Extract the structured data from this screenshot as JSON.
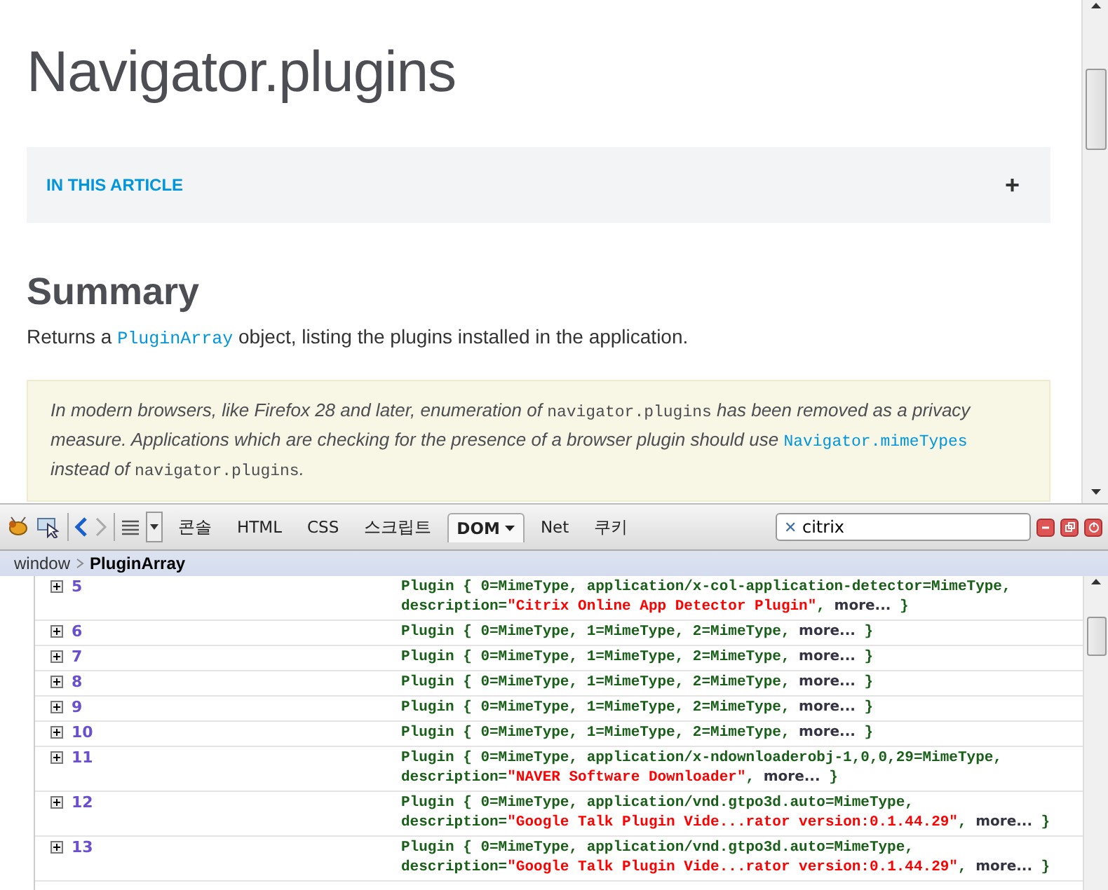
{
  "article": {
    "title": "Navigator.plugins",
    "toc": {
      "label": "IN THIS ARTICLE",
      "toggle": "+",
      "expanded": false
    },
    "heading": "Summary",
    "summary": [
      {
        "kind": "text",
        "text": "Returns a "
      },
      {
        "kind": "link",
        "text": "PluginArray"
      },
      {
        "kind": "text",
        "text": " object, listing the plugins installed in the application."
      }
    ],
    "note": [
      {
        "kind": "text",
        "text": "In modern browsers, like Firefox 28 and later, enumeration of "
      },
      {
        "kind": "code",
        "text": "navigator.plugins"
      },
      {
        "kind": "text",
        "text": " has been removed as a privacy measure. Applications which are checking for the presence of a browser plugin should use "
      },
      {
        "kind": "link",
        "text": "Navigator.mimeTypes"
      },
      {
        "kind": "text",
        "text": " instead of "
      },
      {
        "kind": "code",
        "text": "navigator.plugins"
      },
      {
        "kind": "text",
        "text": "."
      }
    ]
  },
  "devtools": {
    "tabs": [
      {
        "label": "콘솔",
        "selected": false,
        "dropdown": false
      },
      {
        "label": "HTML",
        "selected": false,
        "dropdown": false
      },
      {
        "label": "CSS",
        "selected": false,
        "dropdown": false
      },
      {
        "label": "스크립트",
        "selected": false,
        "dropdown": false
      },
      {
        "label": "DOM",
        "selected": true,
        "dropdown": true
      },
      {
        "label": "Net",
        "selected": false,
        "dropdown": false
      },
      {
        "label": "쿠키",
        "selected": false,
        "dropdown": false
      }
    ],
    "search": {
      "clear": "✕",
      "value": "citrix"
    },
    "breadcrumb": [
      {
        "label": "window",
        "selected": false
      },
      {
        "label": "PluginArray",
        "selected": true
      }
    ],
    "rows": [
      {
        "index": "5",
        "lines": [
          [
            {
              "kind": "plain",
              "text": "Plugin { 0=MimeType, application/x-col-application-detector=MimeType,"
            }
          ],
          [
            {
              "kind": "plain",
              "text": "description="
            },
            {
              "kind": "string",
              "text": "\"Citrix Online App Detector Plugin\""
            },
            {
              "kind": "plain",
              "text": ", "
            },
            {
              "kind": "more",
              "text": "more..."
            },
            {
              "kind": "plain",
              "text": " }"
            }
          ]
        ]
      },
      {
        "index": "6",
        "lines": [
          [
            {
              "kind": "plain",
              "text": "Plugin { 0=MimeType, 1=MimeType, 2=MimeType, "
            },
            {
              "kind": "more",
              "text": "more..."
            },
            {
              "kind": "plain",
              "text": " }"
            }
          ]
        ]
      },
      {
        "index": "7",
        "lines": [
          [
            {
              "kind": "plain",
              "text": "Plugin { 0=MimeType, 1=MimeType, 2=MimeType, "
            },
            {
              "kind": "more",
              "text": "more..."
            },
            {
              "kind": "plain",
              "text": " }"
            }
          ]
        ]
      },
      {
        "index": "8",
        "lines": [
          [
            {
              "kind": "plain",
              "text": "Plugin { 0=MimeType, 1=MimeType, 2=MimeType, "
            },
            {
              "kind": "more",
              "text": "more..."
            },
            {
              "kind": "plain",
              "text": " }"
            }
          ]
        ]
      },
      {
        "index": "9",
        "lines": [
          [
            {
              "kind": "plain",
              "text": "Plugin { 0=MimeType, 1=MimeType, 2=MimeType, "
            },
            {
              "kind": "more",
              "text": "more..."
            },
            {
              "kind": "plain",
              "text": " }"
            }
          ]
        ]
      },
      {
        "index": "10",
        "lines": [
          [
            {
              "kind": "plain",
              "text": "Plugin { 0=MimeType, 1=MimeType, 2=MimeType, "
            },
            {
              "kind": "more",
              "text": "more..."
            },
            {
              "kind": "plain",
              "text": " }"
            }
          ]
        ]
      },
      {
        "index": "11",
        "lines": [
          [
            {
              "kind": "plain",
              "text": "Plugin { 0=MimeType, application/x-ndownloaderobj-1,0,0,29=MimeType,"
            }
          ],
          [
            {
              "kind": "plain",
              "text": "description="
            },
            {
              "kind": "string",
              "text": "\"NAVER Software Downloader\""
            },
            {
              "kind": "plain",
              "text": ", "
            },
            {
              "kind": "more",
              "text": "more..."
            },
            {
              "kind": "plain",
              "text": " }"
            }
          ]
        ]
      },
      {
        "index": "12",
        "lines": [
          [
            {
              "kind": "plain",
              "text": "Plugin { 0=MimeType, application/vnd.gtpo3d.auto=MimeType,"
            }
          ],
          [
            {
              "kind": "plain",
              "text": "description="
            },
            {
              "kind": "string",
              "text": "\"Google Talk Plugin Vide...rator version:0.1.44.29\""
            },
            {
              "kind": "plain",
              "text": ", "
            },
            {
              "kind": "more",
              "text": "more..."
            },
            {
              "kind": "plain",
              "text": " }"
            }
          ]
        ]
      },
      {
        "index": "13",
        "lines": [
          [
            {
              "kind": "plain",
              "text": "Plugin { 0=MimeType, application/vnd.gtpo3d.auto=MimeType,"
            }
          ],
          [
            {
              "kind": "plain",
              "text": "description="
            },
            {
              "kind": "string",
              "text": "\"Google Talk Plugin Vide...rator version:0.1.44.29\""
            },
            {
              "kind": "plain",
              "text": ", "
            },
            {
              "kind": "more",
              "text": "more..."
            },
            {
              "kind": "plain",
              "text": " }"
            }
          ]
        ]
      }
    ]
  }
}
